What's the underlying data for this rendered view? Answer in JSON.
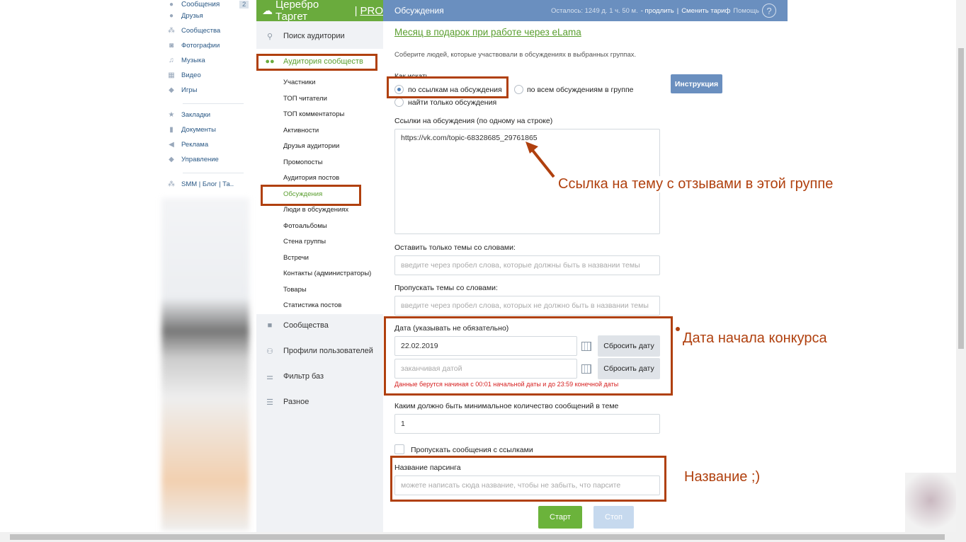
{
  "vk_menu": {
    "items": [
      {
        "label": "Сообщения",
        "icon": "message-icon",
        "badge": "2"
      },
      {
        "label": "Друзья",
        "icon": "user-icon"
      },
      {
        "label": "Сообщества",
        "icon": "users-icon"
      },
      {
        "label": "Фотографии",
        "icon": "camera-icon"
      },
      {
        "label": "Музыка",
        "icon": "music-icon"
      },
      {
        "label": "Видео",
        "icon": "video-icon"
      },
      {
        "label": "Игры",
        "icon": "gamepad-icon"
      },
      {
        "label": "Закладки",
        "icon": "star-icon"
      },
      {
        "label": "Документы",
        "icon": "document-icon"
      },
      {
        "label": "Реклама",
        "icon": "megaphone-icon"
      },
      {
        "label": "Управление",
        "icon": "gamepad-icon"
      },
      {
        "label": "SMM | Блог | Та..",
        "icon": "users-icon"
      }
    ]
  },
  "app": {
    "brand": "Церебро Таргет",
    "brand_pro": "PRO",
    "brand_sep": "|",
    "header": {
      "title": "Обсуждения",
      "remaining": "Осталось: 1249 д. 1 ч. 50 м.",
      "extend": "- продлить",
      "sep": "|",
      "change_plan": "Сменить тариф",
      "help": "Помощь",
      "help_icon": "?"
    }
  },
  "nav": {
    "search": "Поиск аудитории",
    "audience": "Аудитория сообществ",
    "sub": [
      "Участники",
      "ТОП читатели",
      "ТОП комментаторы",
      "Активности",
      "Друзья аудитории",
      "Промопосты",
      "Аудитория постов",
      "Обсуждения",
      "Люди в обсуждениях",
      "Фотоальбомы",
      "Стена группы",
      "Встречи",
      "Контакты (администраторы)",
      "Товары",
      "Статистика постов"
    ],
    "communities": "Сообщества",
    "profiles": "Профили пользователей",
    "filter": "Фильтр баз",
    "misc": "Разное"
  },
  "main": {
    "promo": "Месяц в подарок при работе через eLama",
    "desc": "Соберите людей, которые участвовали в обсуждениях в выбранных группах.",
    "how_label": "Как искать",
    "radio1": "по ссылкам на обсуждения",
    "radio2": "по всем обсуждениям в группе",
    "radio3": "найти только обсуждения",
    "instruction": "Инструкция",
    "links_label": "Ссылки на обсуждения (по одному на строке)",
    "links_value": "https://vk.com/topic-68328685_29761865",
    "keep_label": "Оставить только темы со словами:",
    "keep_ph": "введите через пробел слова, которые должны быть в названии темы",
    "skip_label": "Пропускать темы со словами:",
    "skip_ph": "введите через пробел слова, которых не должно быть в названии темы",
    "date_label": "Дата (указывать не обязательно)",
    "date_from": "22.02.2019",
    "date_to_ph": "заканчивая датой",
    "reset": "Сбросить дату",
    "date_note": "Данные берутся начиная с 00:01 начальной даты и до 23:59 конечной даты",
    "min_label": "Каким должно быть минимальное количество сообщений в теме",
    "min_value": "1",
    "skip_links": "Пропускать сообщения с ссылками",
    "name_label": "Название парсинга",
    "name_ph": "можете написать сюда название, чтобы не забыть, что парсите",
    "start": "Старт",
    "stop": "Стоп"
  },
  "annotations": {
    "link": "Ссылка на тему с отзывами в этой группе",
    "date": "Дата начала конкурса",
    "name": "Название ;)"
  },
  "colors": {
    "green": "#6aab3d",
    "blue": "#6a8fbf",
    "annotation": "#b0400e",
    "error": "#d61f1f",
    "start": "#6bb33b"
  }
}
